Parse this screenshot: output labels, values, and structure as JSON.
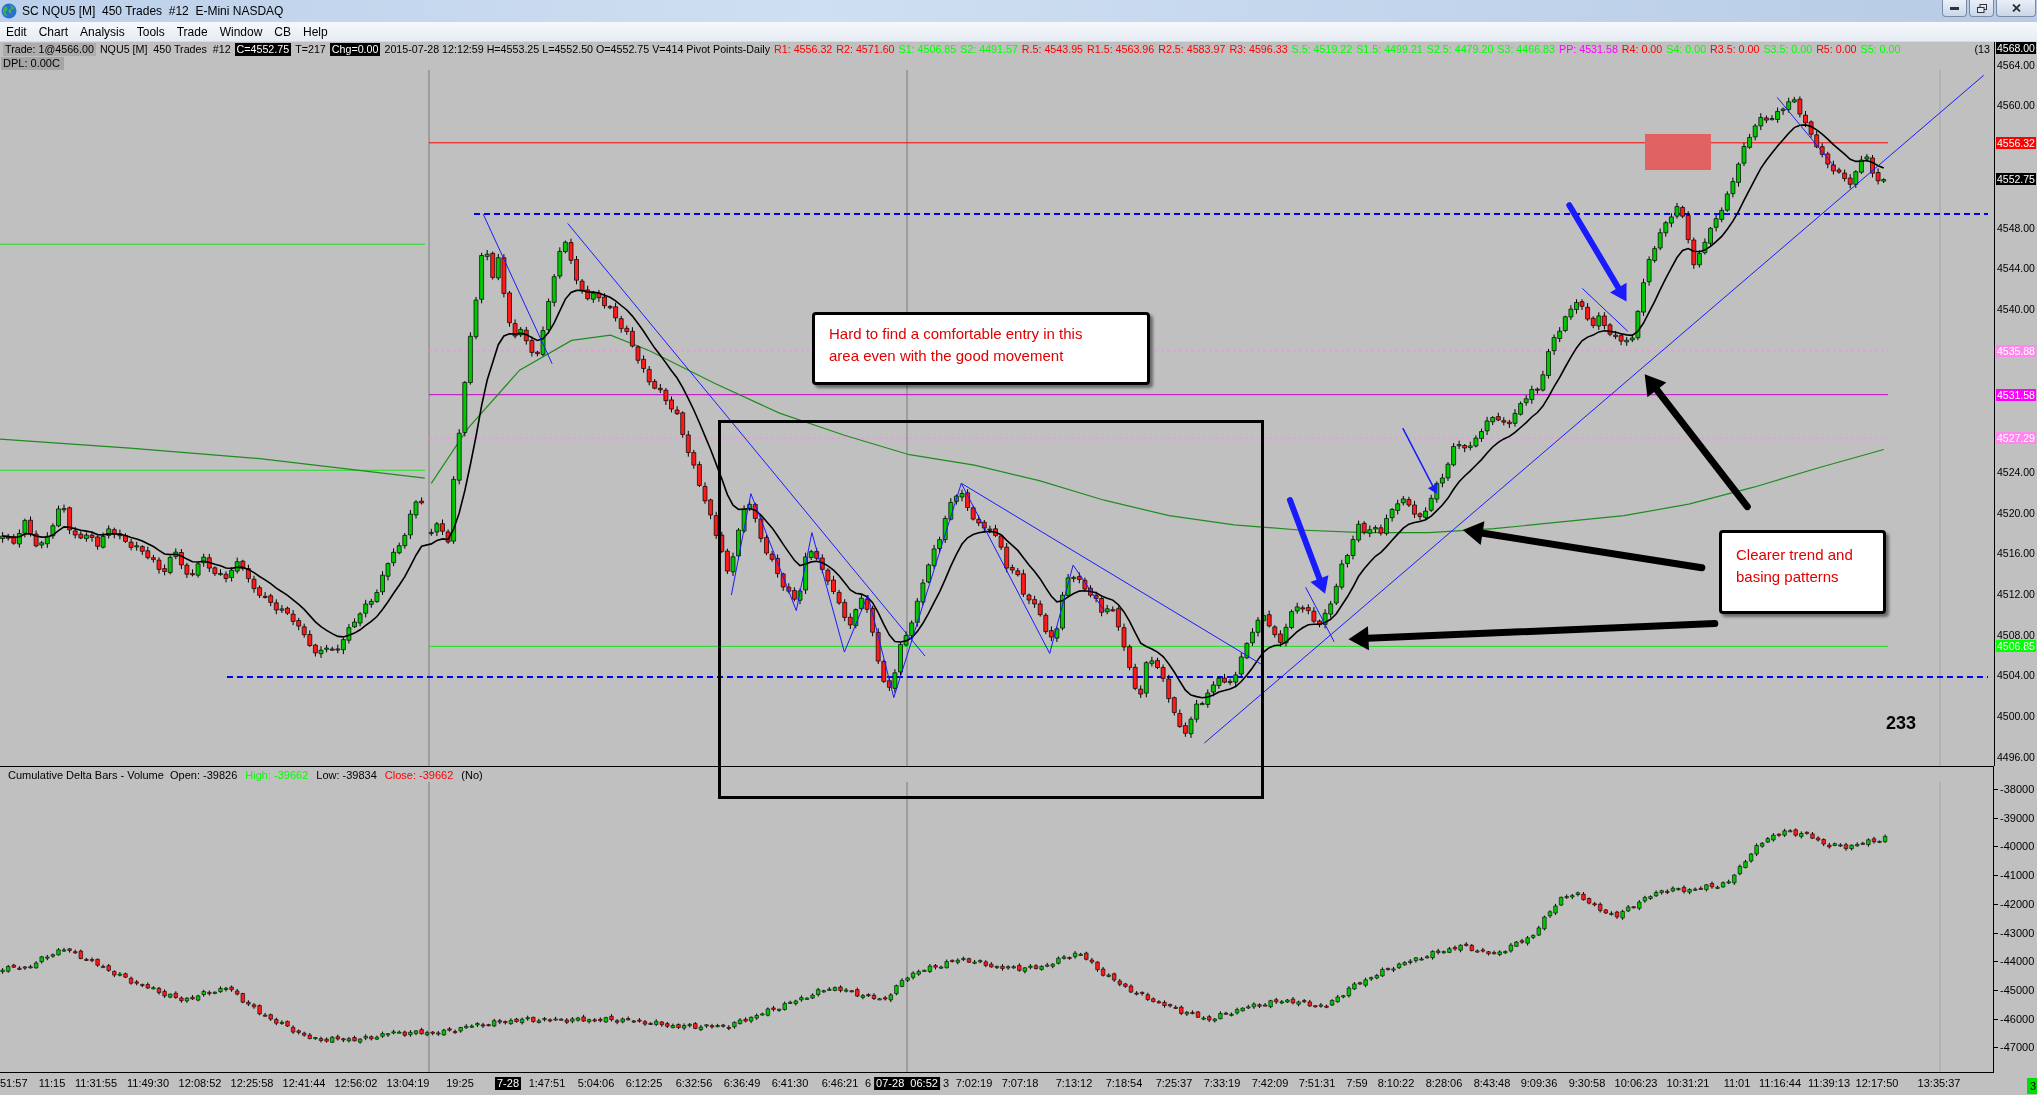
{
  "window": {
    "title": "SC NQU5 [M]  450 Trades  #12  E-Mini NASDAQ"
  },
  "menu": [
    "Edit",
    "Chart",
    "Analysis",
    "Tools",
    "Trade",
    "Window",
    "CB",
    "Help"
  ],
  "info_line": {
    "items": [
      {
        "text": "Trade: 1@4566.00",
        "kind": "shaded"
      },
      {
        "text": "NQU5 [M]  450 Trades  #12",
        "kind": "plain"
      },
      {
        "text": "C=4552.75",
        "kind": "inverse"
      },
      {
        "text": "T=217",
        "kind": "plain"
      },
      {
        "text": "Chg=0.00",
        "kind": "inverse"
      },
      {
        "text": "2015-07-28 12:12:59 H=4553.25 L=4552.50 O=4552.75 V=414 Pivot Points-Daily",
        "kind": "plain"
      }
    ],
    "pivots": [
      {
        "text": "R1: 4556.32",
        "color": "#ff0000"
      },
      {
        "text": "R2: 4571.60",
        "color": "#ff0000"
      },
      {
        "text": "S1: 4506.85",
        "color": "#00ff00"
      },
      {
        "text": "S2: 4491.57",
        "color": "#00ff00"
      },
      {
        "text": "R.5: 4543.95",
        "color": "#ff0000"
      },
      {
        "text": "R1.5: 4563.96",
        "color": "#ff0000"
      },
      {
        "text": "R2.5: 4583.97",
        "color": "#ff0000"
      },
      {
        "text": "R3: 4596.33",
        "color": "#ff0000"
      },
      {
        "text": "S.5: 4519.22",
        "color": "#00ff00"
      },
      {
        "text": "S1.5: 4499.21",
        "color": "#00ff00"
      },
      {
        "text": "S2.5: 4479.20",
        "color": "#00ff00"
      },
      {
        "text": "S3: 4466.83",
        "color": "#00ff00"
      },
      {
        "text": "PP: 4531.58",
        "color": "#ff00ff"
      },
      {
        "text": "R4: 0.00",
        "color": "#ff0000"
      },
      {
        "text": "S4: 0.00",
        "color": "#00ff00"
      },
      {
        "text": "R3.5: 0.00",
        "color": "#ff0000"
      },
      {
        "text": "S3.5: 0.00",
        "color": "#00ff00"
      },
      {
        "text": "R5: 0.00",
        "color": "#ff0000"
      },
      {
        "text": "S5: 0.00",
        "color": "#00ff00"
      }
    ],
    "tail": "(13"
  },
  "dpl": "DPL: 0.00C",
  "price_axis": {
    "ticks": [
      "4564.00",
      "4560.00",
      "4548.00",
      "4544.00",
      "4540.00",
      "4524.00",
      "4520.00",
      "4516.00",
      "4512.00",
      "4508.00",
      "4504.00",
      "4500.00",
      "4496.00"
    ],
    "markers": [
      {
        "label": "4568.00",
        "color": "#000000"
      },
      {
        "label": "4556.32",
        "color": "#ff0000"
      },
      {
        "label": "4552.75",
        "color": "#000000"
      },
      {
        "label": "4535.88",
        "color": "#ff88ee"
      },
      {
        "label": "4531.58",
        "color": "#ff00ff"
      },
      {
        "label": "4527.29",
        "color": "#ff88ee"
      },
      {
        "label": "4506.85",
        "color": "#00ff00"
      }
    ]
  },
  "annotations": [
    {
      "kind": "callout",
      "text": "Hard to find a comfortable entry in this area even with the good movement"
    },
    {
      "kind": "callout",
      "text": "Clearer trend and basing patterns"
    },
    {
      "kind": "label",
      "text": "233"
    }
  ],
  "delta_pane": {
    "legend": [
      {
        "text": "Cumulative Delta Bars - Volume  Open: -39826",
        "color": "#000000"
      },
      {
        "text": "High: -39662",
        "color": "#00ff00"
      },
      {
        "text": "Low: -39834",
        "color": "#000000"
      },
      {
        "text": "Close: -39662",
        "color": "#ff0000"
      },
      {
        "text": "(No)",
        "color": "#000000"
      }
    ],
    "ticks": [
      "-38000",
      "-39000",
      "-40000",
      "-41000",
      "-42000",
      "-43000",
      "-44000",
      "-45000",
      "-46000",
      "-47000"
    ]
  },
  "time_axis": {
    "labels": [
      {
        "text": "51:57",
        "kind": "tick"
      },
      {
        "text": "11:15",
        "kind": "tick"
      },
      {
        "text": "11:31:55",
        "kind": "tick"
      },
      {
        "text": "11:49:30",
        "kind": "tick"
      },
      {
        "text": "12:08:52",
        "kind": "tick"
      },
      {
        "text": "12:25:58",
        "kind": "tick"
      },
      {
        "text": "12:41:44",
        "kind": "tick"
      },
      {
        "text": "12:56:02",
        "kind": "tick"
      },
      {
        "text": "13:04:19",
        "kind": "tick"
      },
      {
        "text": "19:25",
        "kind": "tick"
      },
      {
        "text": "7-28",
        "kind": "cursor"
      },
      {
        "text": "1:47:51",
        "kind": "tick"
      },
      {
        "text": "5:04:06",
        "kind": "tick"
      },
      {
        "text": "6:12:25",
        "kind": "tick"
      },
      {
        "text": "6:32:56",
        "kind": "tick"
      },
      {
        "text": "6:36:49",
        "kind": "tick"
      },
      {
        "text": "6:41:30",
        "kind": "tick"
      },
      {
        "text": "6:46:21",
        "kind": "tick"
      },
      {
        "text": "6",
        "kind": "tick"
      },
      {
        "text": "07-28  06:52",
        "kind": "cursor"
      },
      {
        "text": "3",
        "kind": "tick"
      },
      {
        "text": "7:02:19",
        "kind": "tick"
      },
      {
        "text": "7:07:18",
        "kind": "tick"
      },
      {
        "text": "7:13:12",
        "kind": "tick"
      },
      {
        "text": "7:18:54",
        "kind": "tick"
      },
      {
        "text": "7:25:37",
        "kind": "tick"
      },
      {
        "text": "7:33:19",
        "kind": "tick"
      },
      {
        "text": "7:42:09",
        "kind": "tick"
      },
      {
        "text": "7:51:31",
        "kind": "tick"
      },
      {
        "text": "7:59",
        "kind": "tick"
      },
      {
        "text": "8:10:22",
        "kind": "tick"
      },
      {
        "text": "8:28:06",
        "kind": "tick"
      },
      {
        "text": "8:43:48",
        "kind": "tick"
      },
      {
        "text": "9:09:36",
        "kind": "tick"
      },
      {
        "text": "9:30:58",
        "kind": "tick"
      },
      {
        "text": "10:06:23",
        "kind": "tick"
      },
      {
        "text": "10:31:21",
        "kind": "tick"
      },
      {
        "text": "11:01",
        "kind": "tick"
      },
      {
        "text": "11:16:44",
        "kind": "tick"
      },
      {
        "text": "11:39:13",
        "kind": "tick"
      },
      {
        "text": "12:17:50",
        "kind": "tick"
      },
      {
        "text": "13:35:37",
        "kind": "tick"
      }
    ],
    "corner_badge": "3"
  }
}
